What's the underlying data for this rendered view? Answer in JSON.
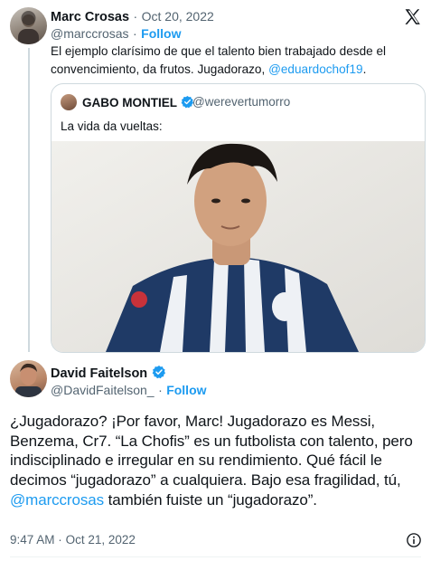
{
  "tweet1": {
    "author_name": "Marc Crosas",
    "dot": "·",
    "date": "Oct 20, 2022",
    "handle": "@marccrosas",
    "follow_label": "Follow",
    "text_line1": "El ejemplo clarísimo de que el talento bien trabajado desde el",
    "text_line2": "convencimiento, da frutos. Jugadorazo, ",
    "mention": "@eduardochof19",
    "text_end": ".",
    "quote": {
      "author_name": "GABO MONTIEL",
      "handle": "@werevertumorro",
      "text": "La vida da vueltas:"
    }
  },
  "tweet2": {
    "author_name": "David Faitelson",
    "handle": "@DavidFaitelson_",
    "dot": "·",
    "follow_label": "Follow",
    "text_part1": "¿Jugadorazo? ¡Por favor, Marc! Jugadorazo es Messi, Benzema, Cr7. “La Chofis” es un futbolista con talento, pero indisciplinado e irregular en su rendimiento. Qué fácil le decimos “jugadorazo” a cualquiera. Bajo esa fragilidad, tú, ",
    "mention": "@marccrosas",
    "text_part2": " también fuiste un “jugadorazo”.",
    "time": "9:47 AM",
    "dot2": "·",
    "date": "Oct 21, 2022"
  },
  "icons": {
    "x_logo": "x-logo-icon",
    "verified": "verified-badge-icon",
    "info": "info-icon"
  },
  "colors": {
    "link": "#1d9bf0",
    "muted": "#536471",
    "border": "#cfd9de"
  }
}
